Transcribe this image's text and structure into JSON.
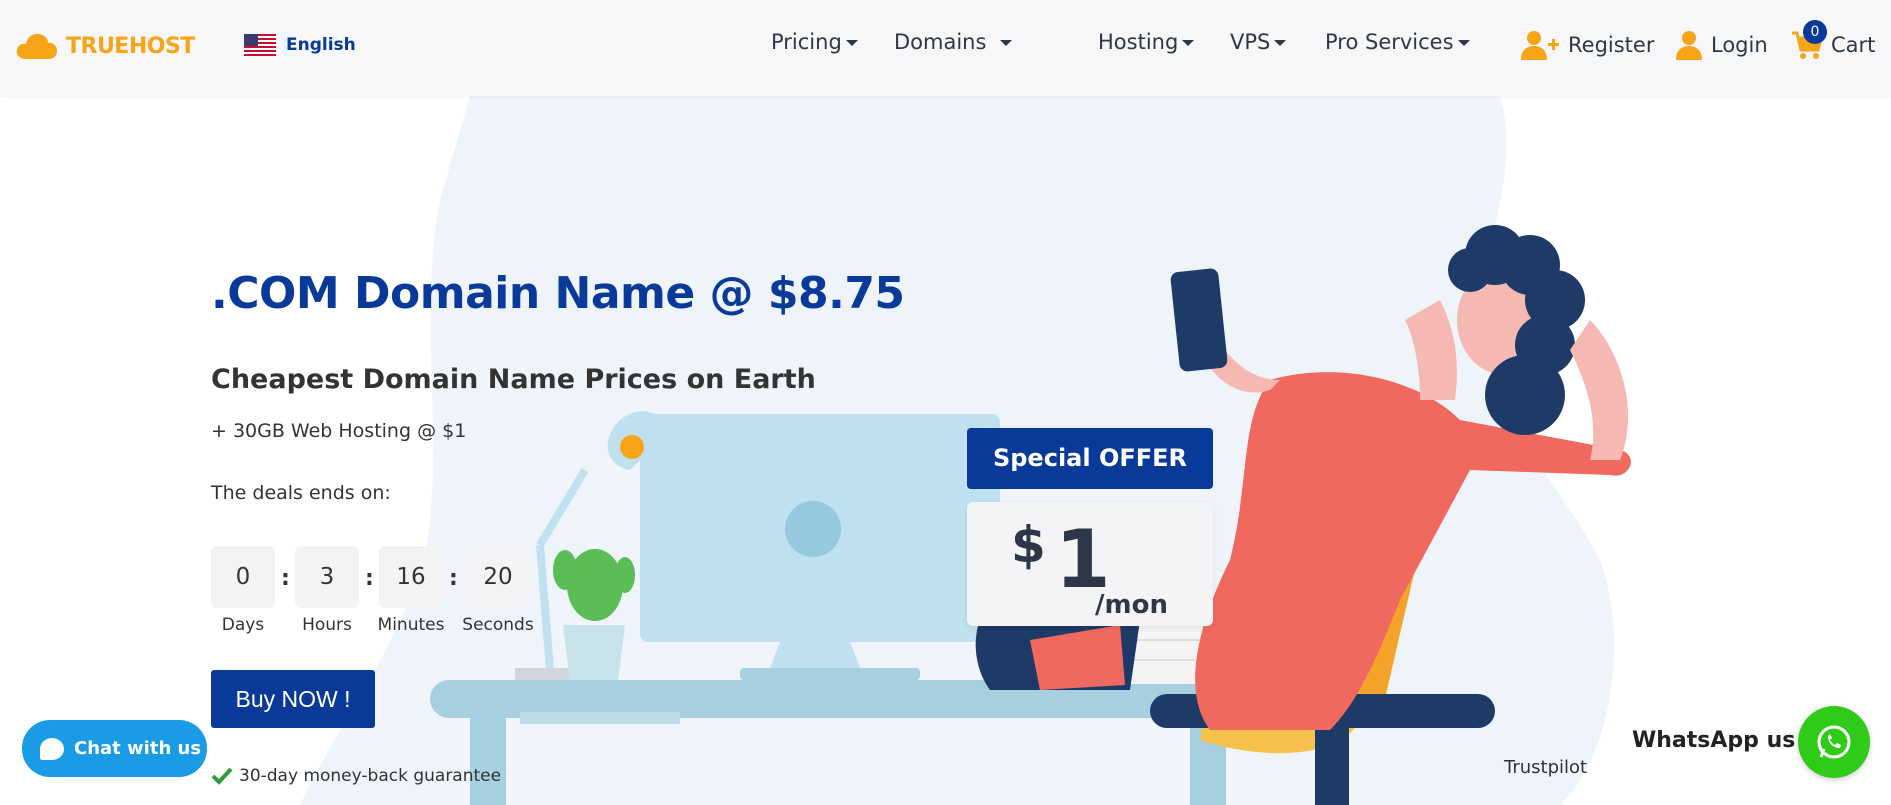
{
  "header": {
    "brand": "TRUEHOST",
    "language": "English",
    "nav": [
      {
        "label": "Pricing"
      },
      {
        "label": "Domains"
      },
      {
        "label": "Hosting"
      },
      {
        "label": "VPS"
      },
      {
        "label": "Pro Services"
      }
    ],
    "register_label": "Register",
    "login_label": "Login",
    "cart_label": "Cart",
    "cart_count": "0"
  },
  "hero": {
    "headline": ".COM Domain Name @ $8.75",
    "subheadline": "Cheapest Domain Name Prices on Earth",
    "tagline": "+ 30GB Web Hosting @ $1",
    "deals_label": "The deals ends on:",
    "countdown": {
      "days": "0",
      "hours": "3",
      "minutes": "16",
      "seconds": "20",
      "days_label": "Days",
      "hours_label": "Hours",
      "minutes_label": "Minutes",
      "seconds_label": "Seconds"
    },
    "buy_label": "Buy NOW !",
    "guarantee": "30-day money-back guarantee"
  },
  "offer": {
    "title": "Special OFFER",
    "currency": "$",
    "amount": "1",
    "unit": "/mon"
  },
  "chat": {
    "label": "Chat with us"
  },
  "whatsapp": {
    "label": "WhatsApp us"
  },
  "trustpilot": {
    "label": "Trustpilot"
  },
  "colors": {
    "brand_orange": "#f7a416",
    "primary_blue": "#0a3a99",
    "chat_blue": "#1a9be6",
    "whatsapp_green": "#2fcb18"
  }
}
